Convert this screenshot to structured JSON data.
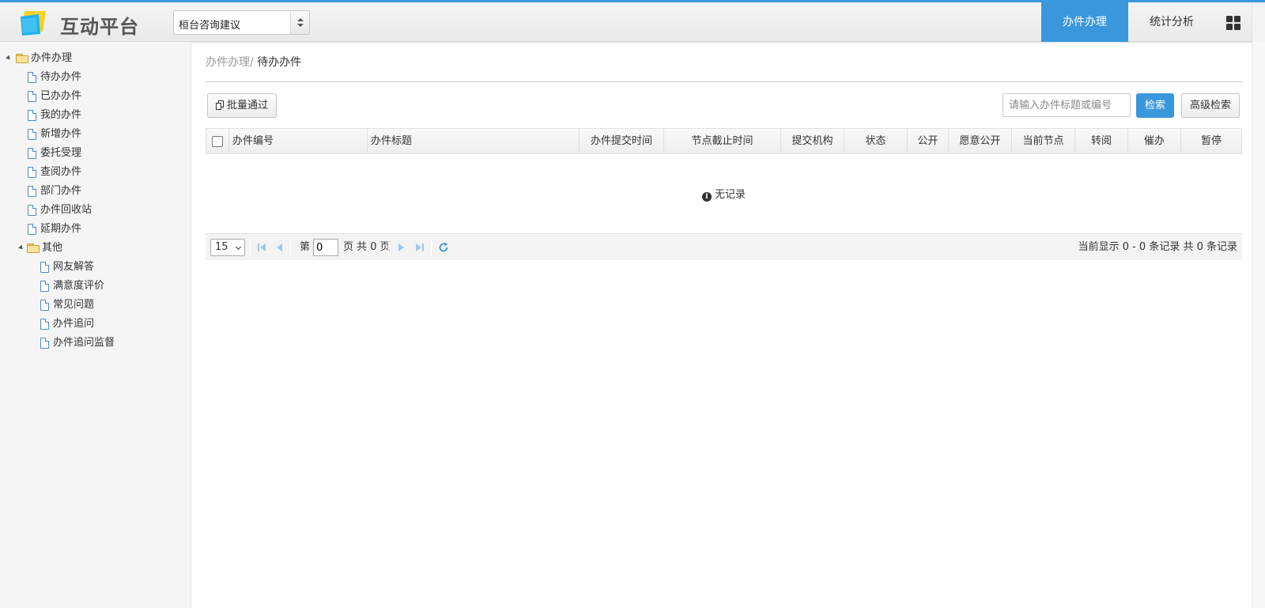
{
  "app": {
    "title": "互动平台",
    "system_select": "桓台咨询建议"
  },
  "nav": {
    "tabs": [
      {
        "label": "办件办理",
        "active": true
      },
      {
        "label": "统计分析",
        "active": false
      }
    ],
    "grid_icon": "apps-grid-icon"
  },
  "sidebar": {
    "groups": [
      {
        "label": "办件办理",
        "expanded": true,
        "items": [
          "待办办件",
          "已办办件",
          "我的办件",
          "新增办件",
          "委托受理",
          "查阅办件",
          "部门办件",
          "办件回收站",
          "延期办件"
        ]
      },
      {
        "label": "其他",
        "expanded": true,
        "items": [
          "网友解答",
          "满意度评价",
          "常见问题",
          "办件追问",
          "办件追问监督"
        ]
      }
    ]
  },
  "breadcrumb": {
    "parent": "办件办理/",
    "current": "待办办件"
  },
  "toolbar": {
    "batch_label": "批量通过",
    "search_placeholder": "请输入办件标题或编号",
    "search_value": "",
    "search_label": "检索",
    "advanced_label": "高级检索"
  },
  "table": {
    "columns": [
      "办件编号",
      "办件标题",
      "办件提交时间",
      "节点截止时间",
      "提交机构",
      "状态",
      "公开",
      "愿意公开",
      "当前节点",
      "转阅",
      "催办",
      "暂停"
    ],
    "rows": [],
    "empty_text": "无记录"
  },
  "pager": {
    "page_size": "15",
    "page_prefix": "第",
    "page_value": "0",
    "page_suffix": "页 共 0 页",
    "summary": "当前显示 0 - 0 条记录 共 0 条记录"
  },
  "colors": {
    "accent": "#3a97dc",
    "sidebar_bg": "#f5f5f5"
  }
}
